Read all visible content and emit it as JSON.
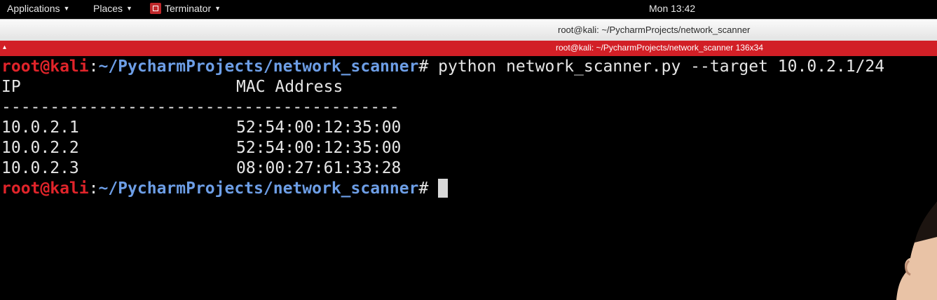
{
  "panel": {
    "applications": "Applications",
    "places": "Places",
    "terminator": "Terminator",
    "clock": "Mon 13:42"
  },
  "window": {
    "title": "root@kali: ~/PycharmProjects/network_scanner",
    "header_title": "root@kali: ~/PycharmProjects/network_scanner 136x34"
  },
  "terminal": {
    "prompt_user": "root@kali",
    "prompt_path": "~/PycharmProjects/network_scanner",
    "command": "python network_scanner.py --target 10.0.2.1/24",
    "header_ip": "IP",
    "header_mac": "MAC Address",
    "separator": "-----------------------------------------",
    "rows": [
      {
        "ip": "10.0.2.1",
        "mac": "52:54:00:12:35:00"
      },
      {
        "ip": "10.0.2.2",
        "mac": "52:54:00:12:35:00"
      },
      {
        "ip": "10.0.2.3",
        "mac": "08:00:27:61:33:28"
      }
    ]
  },
  "colors": {
    "prompt_user": "#e0242a",
    "prompt_path": "#6d9ee6",
    "header_strip": "#d21f26"
  }
}
